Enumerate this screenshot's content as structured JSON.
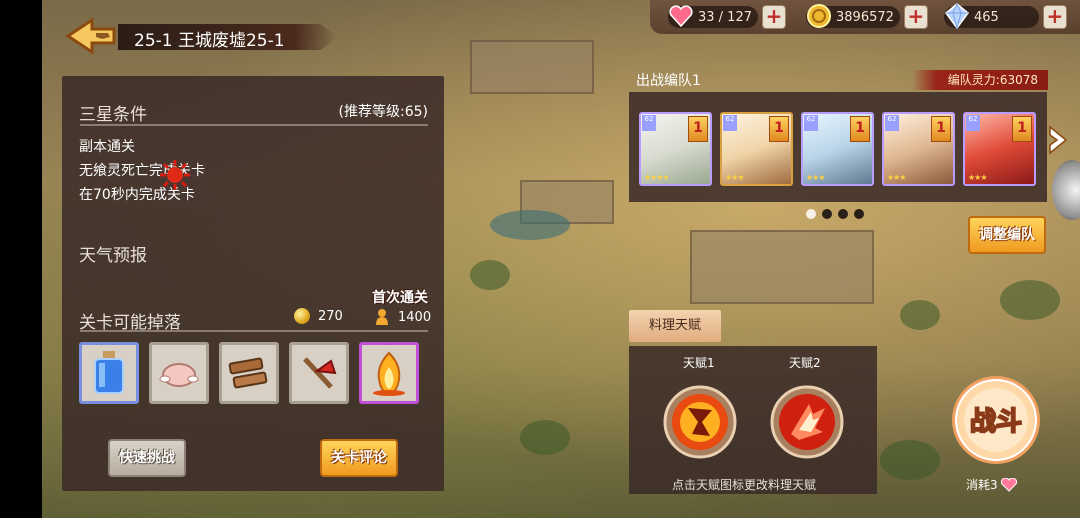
{
  "header": {
    "stage_title": "25-1 王城废墟25-1"
  },
  "resources": {
    "stamina": "33 / 127",
    "gold": "3896572",
    "crystal": "465",
    "plus_label": "+"
  },
  "stage_panel": {
    "three_star_title": "三星条件",
    "recommended_level": "(推荐等级:65)",
    "conditions": [
      "副本通关",
      "无飨灵死亡完成关卡",
      "在70秒内完成关卡"
    ],
    "weather_title": "天气预报",
    "weather_icon": "sun-icon",
    "drops_title": "关卡可能掉落",
    "first_clear_label": "首次通关",
    "reward_gold": "270",
    "reward_exp": "1400",
    "drops": [
      {
        "icon": "blue-potion-icon",
        "rarity": "blue"
      },
      {
        "icon": "chicken-icon",
        "rarity": "normal"
      },
      {
        "icon": "wood-icon",
        "rarity": "normal"
      },
      {
        "icon": "axe-icon",
        "rarity": "normal"
      },
      {
        "icon": "flame-icon",
        "rarity": "purple"
      }
    ],
    "quick_challenge_label": "快速挑战",
    "review_label": "关卡评论"
  },
  "team": {
    "title": "出战编队1",
    "power": "编队灵力:63078",
    "heroes": [
      {
        "level": "62",
        "card": "1",
        "stars": "★★★★"
      },
      {
        "level": "62",
        "card": "1",
        "stars": "★★★"
      },
      {
        "level": "62",
        "card": "1",
        "stars": "★★★"
      },
      {
        "level": "62",
        "card": "1",
        "stars": "★★★"
      },
      {
        "level": "62",
        "card": "1",
        "stars": "★★★"
      }
    ],
    "adjust_label": "调整编队"
  },
  "talent": {
    "tab_label": "料理天赋",
    "talent1_label": "天赋1",
    "talent2_label": "天赋2",
    "hint": "点击天赋图标更改料理天赋"
  },
  "battle": {
    "label": "战斗",
    "consume": "消耗3"
  },
  "colors": {
    "accent_orange": "#f09a20",
    "panel_brown": "#3a2a28",
    "power_red": "#8a1c12"
  }
}
